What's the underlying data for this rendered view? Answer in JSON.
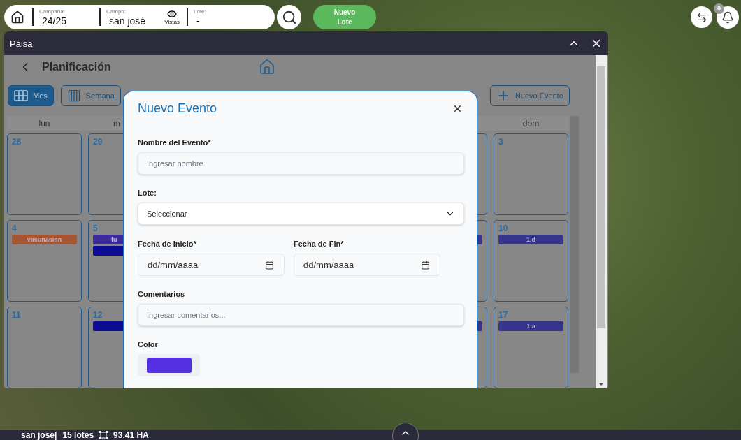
{
  "topbar": {
    "fields": [
      {
        "label": "Campaña:",
        "value": "24/25"
      },
      {
        "label": "Campo:",
        "value": "san josé",
        "views_label": "Vistas"
      },
      {
        "label": "Lote:",
        "value": "-"
      }
    ],
    "new_lot_button": "Nuevo Lote",
    "notifications_count": "0"
  },
  "window": {
    "title": "Paisa"
  },
  "page": {
    "title": "Planificación",
    "view_buttons": [
      {
        "label": "Mes",
        "kind": "grid",
        "selected": true
      },
      {
        "label": "Semana",
        "kind": "columns",
        "selected": false
      }
    ],
    "new_event_button": "Nuevo Evento",
    "calendar": {
      "weekdays": {
        "mon": "lun",
        "tue": "m",
        "sun": "dom"
      },
      "weeks": [
        {
          "cells": [
            {
              "day": "28"
            },
            {
              "day": "29"
            },
            null,
            null,
            null,
            {},
            {
              "day": "3"
            }
          ]
        },
        {
          "cells": [
            {
              "day": "4",
              "events": [
                {
                  "label": "vacunacion",
                  "color": "#a65432"
                }
              ]
            },
            {
              "day": "5",
              "events": [
                {
                  "label": "fu",
                  "color": "#3c2a9a"
                },
                {
                  "color": "#0b0b96"
                }
              ]
            },
            null,
            null,
            null,
            {
              "events": [
                {
                  "color": "#35358a"
                }
              ]
            },
            {
              "day": "10",
              "events": [
                {
                  "label": "1.d",
                  "color": "#35358a"
                }
              ]
            }
          ]
        },
        {
          "cells": [
            {
              "day": "11"
            },
            {
              "day": "12",
              "events": [
                {
                  "color": "#0b0b96"
                }
              ]
            },
            null,
            null,
            null,
            {
              "events": [
                {
                  "color": "#35358a"
                }
              ]
            },
            {
              "day": "17",
              "events": [
                {
                  "label": "1.a",
                  "color": "#35358a"
                }
              ]
            }
          ]
        }
      ]
    }
  },
  "modal": {
    "title": "Nuevo Evento",
    "name_field": {
      "label": "Nombre del Evento*",
      "placeholder": "Ingresar nombre"
    },
    "lot_field": {
      "label": "Lote:",
      "value": "Seleccionar"
    },
    "start_field": {
      "label": "Fecha de Inicio*",
      "placeholder": "dd/mm/aaaa"
    },
    "end_field": {
      "label": "Fecha de Fin*",
      "placeholder": "dd/mm/aaaa"
    },
    "comments_field": {
      "label": "Comentarios",
      "placeholder": "Ingresar comentarios..."
    },
    "color_field": {
      "label": "Color",
      "color": "#5530e0"
    }
  },
  "status_bar": {
    "field": "san josé|",
    "lots": "15 lotes",
    "area": "93.41 HA"
  }
}
